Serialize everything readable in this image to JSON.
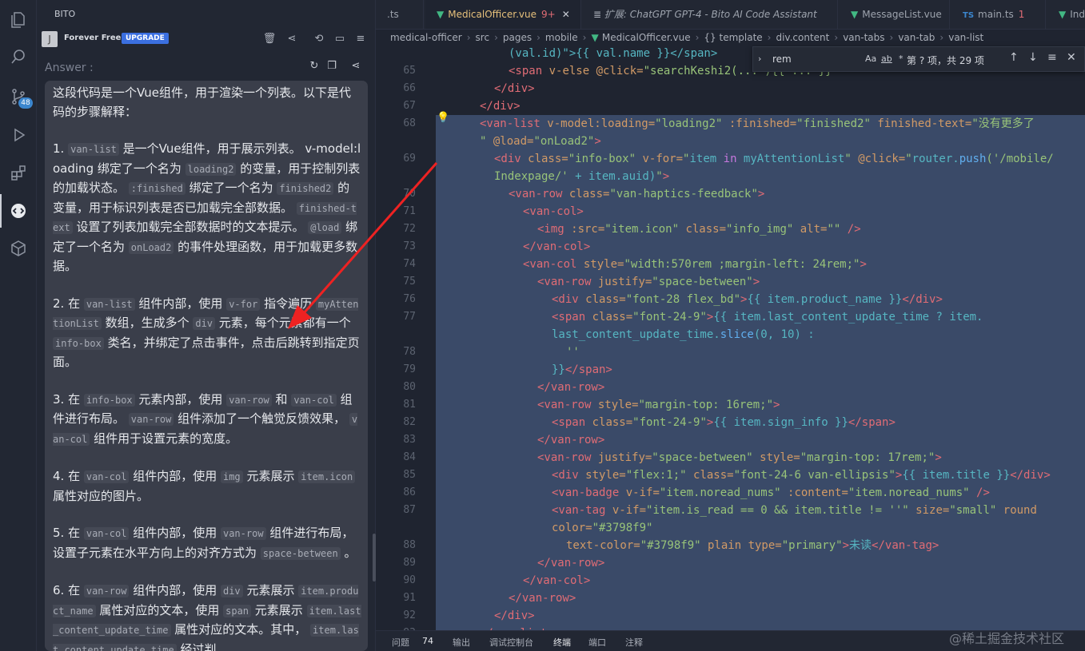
{
  "activity_bar": {
    "items": [
      "explorer-icon",
      "search-icon",
      "source-control-icon",
      "run-debug-icon",
      "extensions-icon",
      "bito-icon",
      "remote-icon"
    ],
    "scm_badge": "48"
  },
  "sidebar": {
    "title": "BITO",
    "plan": {
      "avatar": "J",
      "label": "Forever Free",
      "upgrade": "UPGRADE"
    },
    "answer_label": "Answer :",
    "paragraphs": [
      [
        {
          "t": "这段代码是一个Vue组件，用于渲染一个列表。以下是代码的步骤解释："
        }
      ],
      [
        {
          "t": "1. "
        },
        {
          "c": "van-list"
        },
        {
          "t": " 是一个Vue组件，用于展示列表。 v-model:loading 绑定了一个名为 "
        },
        {
          "c": "loading2"
        },
        {
          "t": " 的变量，用于控制列表的加载状态。 "
        },
        {
          "c": ":finished"
        },
        {
          "t": " 绑定了一个名为 "
        },
        {
          "c": "finished2"
        },
        {
          "t": " 的变量，用于标识列表是否已加载完全部数据。 "
        },
        {
          "c": "finished-text"
        },
        {
          "t": " 设置了列表加载完全部数据时的文本提示。 "
        },
        {
          "c": "@load"
        },
        {
          "t": " 绑定了一个名为 "
        },
        {
          "c": "onLoad2"
        },
        {
          "t": " 的事件处理函数，用于加载更多数据。"
        }
      ],
      [
        {
          "t": "2. 在 "
        },
        {
          "c": "van-list"
        },
        {
          "t": " 组件内部，使用 "
        },
        {
          "c": "v-for"
        },
        {
          "t": " 指令遍历 "
        },
        {
          "c": "myAttentionList"
        },
        {
          "t": " 数组，生成多个 "
        },
        {
          "c": "div"
        },
        {
          "t": " 元素，每个元素都有一个 "
        },
        {
          "c": "info-box"
        },
        {
          "t": " 类名，并绑定了点击事件，点击后跳转到指定页面。"
        }
      ],
      [
        {
          "t": "3. 在 "
        },
        {
          "c": "info-box"
        },
        {
          "t": " 元素内部，使用 "
        },
        {
          "c": "van-row"
        },
        {
          "t": " 和 "
        },
        {
          "c": "van-col"
        },
        {
          "t": " 组件进行布局。 "
        },
        {
          "c": "van-row"
        },
        {
          "t": " 组件添加了一个触觉反馈效果， "
        },
        {
          "c": "van-col"
        },
        {
          "t": " 组件用于设置元素的宽度。"
        }
      ],
      [
        {
          "t": "4. 在 "
        },
        {
          "c": "van-col"
        },
        {
          "t": " 组件内部，使用 "
        },
        {
          "c": "img"
        },
        {
          "t": " 元素展示 "
        },
        {
          "c": "item.icon"
        },
        {
          "t": " 属性对应的图片。"
        }
      ],
      [
        {
          "t": "5. 在 "
        },
        {
          "c": "van-col"
        },
        {
          "t": " 组件内部，使用 "
        },
        {
          "c": "van-row"
        },
        {
          "t": " 组件进行布局，设置子元素在水平方向上的对齐方式为 "
        },
        {
          "c": "space-between"
        },
        {
          "t": " 。"
        }
      ],
      [
        {
          "t": "6. 在 "
        },
        {
          "c": "van-row"
        },
        {
          "t": " 组件内部，使用 "
        },
        {
          "c": "div"
        },
        {
          "t": " 元素展示 "
        },
        {
          "c": "item.product_name"
        },
        {
          "t": " 属性对应的文本，使用 "
        },
        {
          "c": "span"
        },
        {
          "t": " 元素展示 "
        },
        {
          "c": "item.last_content_update_time"
        },
        {
          "t": " 属性对应的文本。其中， "
        },
        {
          "c": "item.last_content_update_time"
        },
        {
          "t": " 经过判"
        }
      ]
    ]
  },
  "tabs": [
    {
      "label": ".ts"
    },
    {
      "label": "MedicalOfficer.vue",
      "badge": "9+",
      "icon": "vue-icon",
      "active": true
    },
    {
      "label": "扩展: ChatGPT GPT-4 - Bito AI Code Assistant",
      "icon": "extension-icon"
    },
    {
      "label": "MessageList.vue",
      "icon": "vue-icon"
    },
    {
      "label": "main.ts",
      "badge": "1",
      "icon": "ts-icon"
    },
    {
      "label": "Ind",
      "icon": "vue-icon"
    }
  ],
  "breadcrumbs": [
    "medical-officer",
    "src",
    "pages",
    "mobile",
    "MedicalOfficer.vue",
    "{} template",
    "div.content",
    "van-tabs",
    "van-tab",
    "van-list"
  ],
  "find": {
    "query": "rem",
    "opts": [
      "Aa",
      "ab",
      "*"
    ],
    "count": "第 ? 项，共 29 项"
  },
  "code_lines": [
    {
      "n": "",
      "i": 8,
      "s": [
        [
          "p",
          "(val.id)\">{{ val.name }}</span>"
        ]
      ]
    },
    {
      "n": "65",
      "i": 8,
      "s": [
        [
          "t",
          "<span"
        ],
        [
          "a",
          " v-else @click="
        ],
        [
          "s",
          "\"searchKeshi2(... ){{ ... }}\""
        ]
      ]
    },
    {
      "n": "66",
      "i": 7,
      "s": [
        [
          "t",
          "</div>"
        ]
      ]
    },
    {
      "n": "67",
      "i": 6,
      "s": [
        [
          "t",
          "</div>"
        ]
      ]
    },
    {
      "n": "68",
      "i": 6,
      "s": [
        [
          "t",
          "<van-list"
        ],
        [
          "a",
          " v-model:loading="
        ],
        [
          "s",
          "\"loading2\""
        ],
        [
          "a",
          " :finished="
        ],
        [
          "s",
          "\"finished2\""
        ],
        [
          "a",
          " finished-text="
        ],
        [
          "s",
          "\"没有更多了"
        ]
      ]
    },
    {
      "n": "",
      "i": 6,
      "s": [
        [
          "s",
          "\""
        ],
        [
          "a",
          " @load="
        ],
        [
          "s",
          "\"onLoad2\""
        ],
        [
          "t",
          ">"
        ]
      ]
    },
    {
      "n": "69",
      "i": 7,
      "s": [
        [
          "t",
          "<div"
        ],
        [
          "a",
          " class="
        ],
        [
          "s",
          "\"info-box\""
        ],
        [
          "a",
          " v-for="
        ],
        [
          "s",
          "\""
        ],
        [
          "p",
          "item "
        ],
        [
          "k",
          "in"
        ],
        [
          "p",
          " myAttentionList"
        ],
        [
          "s",
          "\""
        ],
        [
          "a",
          " @click="
        ],
        [
          "s",
          "\""
        ],
        [
          "p",
          "router."
        ],
        [
          "f",
          "push"
        ],
        [
          "s",
          "('/mobile/"
        ]
      ]
    },
    {
      "n": "",
      "i": 7,
      "s": [
        [
          "s",
          "Indexpage/'"
        ],
        [
          "p",
          " + item.auid)"
        ],
        [
          "s",
          "\""
        ],
        [
          "t",
          ">"
        ]
      ]
    },
    {
      "n": "70",
      "i": 8,
      "s": [
        [
          "t",
          "<van-row"
        ],
        [
          "a",
          " class="
        ],
        [
          "s",
          "\"van-haptics-feedback\""
        ],
        [
          "t",
          ">"
        ]
      ]
    },
    {
      "n": "71",
      "i": 9,
      "s": [
        [
          "t",
          "<van-col>"
        ]
      ]
    },
    {
      "n": "72",
      "i": 10,
      "s": [
        [
          "t",
          "<img"
        ],
        [
          "a",
          " :src="
        ],
        [
          "s",
          "\"item.icon\""
        ],
        [
          "a",
          " class="
        ],
        [
          "s",
          "\"info_img\""
        ],
        [
          "a",
          " alt="
        ],
        [
          "s",
          "\"\""
        ],
        [
          "t",
          " />"
        ]
      ]
    },
    {
      "n": "73",
      "i": 9,
      "s": [
        [
          "t",
          "</van-col>"
        ]
      ]
    },
    {
      "n": "74",
      "i": 9,
      "s": [
        [
          "t",
          "<van-col"
        ],
        [
          "a",
          " style="
        ],
        [
          "s",
          "\"width:570rem ;margin-left: 24rem;\""
        ],
        [
          "t",
          ">"
        ]
      ]
    },
    {
      "n": "75",
      "i": 10,
      "s": [
        [
          "t",
          "<van-row"
        ],
        [
          "a",
          " justify="
        ],
        [
          "s",
          "\"space-between\""
        ],
        [
          "t",
          ">"
        ]
      ]
    },
    {
      "n": "76",
      "i": 11,
      "s": [
        [
          "t",
          "<div"
        ],
        [
          "a",
          " class="
        ],
        [
          "s",
          "\"font-28 flex_bd\""
        ],
        [
          "t",
          ">"
        ],
        [
          "p",
          "{{ item.product_name }}"
        ],
        [
          "t",
          "</div>"
        ]
      ]
    },
    {
      "n": "77",
      "i": 11,
      "s": [
        [
          "t",
          "<span"
        ],
        [
          "a",
          " class="
        ],
        [
          "s",
          "\"font-24-9\""
        ],
        [
          "t",
          ">"
        ],
        [
          "p",
          "{{ item.last_content_update_time ? item."
        ]
      ]
    },
    {
      "n": "",
      "i": 11,
      "s": [
        [
          "p",
          "last_content_update_time."
        ],
        [
          "f",
          "slice"
        ],
        [
          "p",
          "(0, 10) :"
        ]
      ]
    },
    {
      "n": "78",
      "i": 12,
      "s": [
        [
          "s",
          "''"
        ]
      ]
    },
    {
      "n": "79",
      "i": 11,
      "s": [
        [
          "p",
          "}}"
        ],
        [
          "t",
          "</span>"
        ]
      ]
    },
    {
      "n": "80",
      "i": 10,
      "s": [
        [
          "t",
          "</van-row>"
        ]
      ]
    },
    {
      "n": "81",
      "i": 10,
      "s": [
        [
          "t",
          "<van-row"
        ],
        [
          "a",
          " style="
        ],
        [
          "s",
          "\"margin-top: 16rem;\""
        ],
        [
          "t",
          ">"
        ]
      ]
    },
    {
      "n": "82",
      "i": 11,
      "s": [
        [
          "t",
          "<span"
        ],
        [
          "a",
          " class="
        ],
        [
          "s",
          "\"font-24-9\""
        ],
        [
          "t",
          ">"
        ],
        [
          "p",
          "{{ item.sign_info }}"
        ],
        [
          "t",
          "</span>"
        ]
      ]
    },
    {
      "n": "83",
      "i": 10,
      "s": [
        [
          "t",
          "</van-row>"
        ]
      ]
    },
    {
      "n": "84",
      "i": 10,
      "s": [
        [
          "t",
          "<van-row"
        ],
        [
          "a",
          " justify="
        ],
        [
          "s",
          "\"space-between\""
        ],
        [
          "a",
          " style="
        ],
        [
          "s",
          "\"margin-top: 17rem;\""
        ],
        [
          "t",
          ">"
        ]
      ]
    },
    {
      "n": "85",
      "i": 11,
      "s": [
        [
          "t",
          "<div"
        ],
        [
          "a",
          " style="
        ],
        [
          "s",
          "\"flex:1;\""
        ],
        [
          "a",
          " class="
        ],
        [
          "s",
          "\"font-24-6 van-ellipsis\""
        ],
        [
          "t",
          ">"
        ],
        [
          "p",
          "{{ item.title }}"
        ],
        [
          "t",
          "</div>"
        ]
      ]
    },
    {
      "n": "86",
      "i": 11,
      "s": [
        [
          "t",
          "<van-badge"
        ],
        [
          "a",
          " v-if="
        ],
        [
          "s",
          "\"item.noread_nums\""
        ],
        [
          "a",
          " :content="
        ],
        [
          "s",
          "\"item.noread_nums\""
        ],
        [
          "t",
          " />"
        ]
      ]
    },
    {
      "n": "87",
      "i": 11,
      "s": [
        [
          "t",
          "<van-tag"
        ],
        [
          "a",
          " v-if="
        ],
        [
          "s",
          "\"item.is_read == 0 && item.title != ''\""
        ],
        [
          "a",
          " size="
        ],
        [
          "s",
          "\"small\""
        ],
        [
          "a",
          " round"
        ]
      ]
    },
    {
      "n": "",
      "i": 11,
      "s": [
        [
          "a",
          "color="
        ],
        [
          "s",
          "\"#3798f9\""
        ]
      ]
    },
    {
      "n": "88",
      "i": 12,
      "s": [
        [
          "a",
          "text-color="
        ],
        [
          "s",
          "\"#3798f9\""
        ],
        [
          "a",
          " plain type="
        ],
        [
          "s",
          "\"primary\""
        ],
        [
          "t",
          ">"
        ],
        [
          "p",
          "未读"
        ],
        [
          "t",
          "</van-tag>"
        ]
      ]
    },
    {
      "n": "89",
      "i": 10,
      "s": [
        [
          "t",
          "</van-row>"
        ]
      ]
    },
    {
      "n": "90",
      "i": 9,
      "s": [
        [
          "t",
          "</van-col>"
        ]
      ]
    },
    {
      "n": "91",
      "i": 8,
      "s": [
        [
          "t",
          "</van-row>"
        ]
      ]
    },
    {
      "n": "92",
      "i": 7,
      "s": [
        [
          "t",
          "</div>"
        ]
      ]
    },
    {
      "n": "93",
      "i": 6,
      "s": [
        [
          "t",
          "</van-list>"
        ]
      ]
    }
  ],
  "panel": {
    "tabs": [
      "问题",
      "输出",
      "调试控制台",
      "终端",
      "端口",
      "注释"
    ],
    "problems_count": "74",
    "active": "终端"
  },
  "watermark": "@稀土掘金技术社区"
}
